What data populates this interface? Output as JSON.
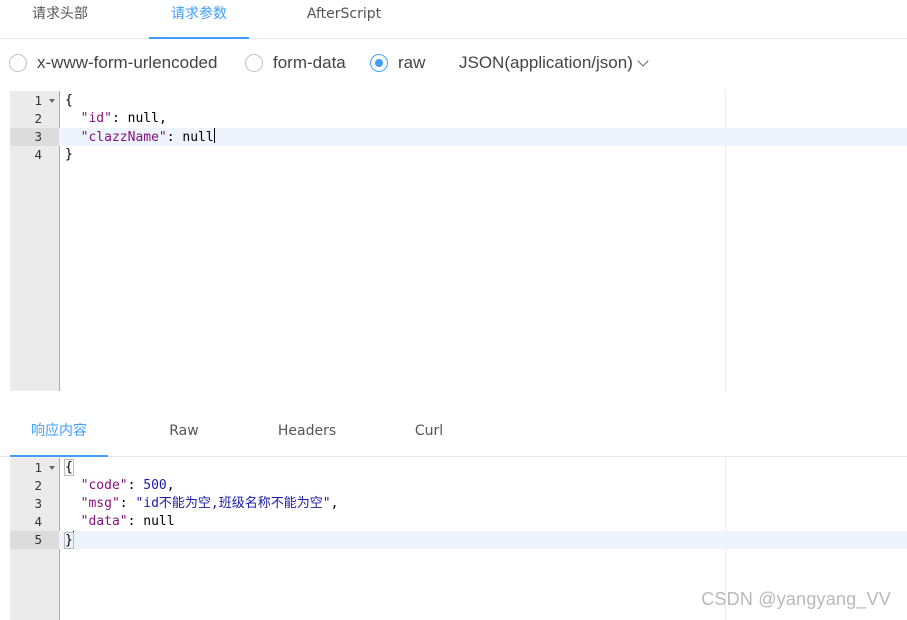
{
  "request_tabs": [
    "请求头部",
    "请求参数",
    "AfterScript"
  ],
  "body_types": {
    "options": [
      "x-www-form-urlencoded",
      "form-data",
      "raw"
    ],
    "selected": "raw",
    "content_type": "JSON(application/json)"
  },
  "request_editor": {
    "line_numbers": [
      "1",
      "2",
      "3",
      "4"
    ],
    "open_brace": "{",
    "close_brace": "}",
    "key_id": "\"id\"",
    "key_clazz": "\"clazzName\"",
    "colon": ": ",
    "null": "null",
    "comma": ","
  },
  "response_tabs": [
    "响应内容",
    "Raw",
    "Headers",
    "Curl"
  ],
  "response_editor": {
    "line_numbers": [
      "1",
      "2",
      "3",
      "4",
      "5"
    ],
    "open_brace": "{",
    "close_brace": "}",
    "key_code": "\"code\"",
    "val_code": "500",
    "key_msg": "\"msg\"",
    "val_msg": "\"id不能为空,班级名称不能为空\"",
    "key_data": "\"data\"",
    "val_data": "null",
    "colon": ": ",
    "comma": ","
  },
  "watermark": "CSDN @yangyang_VV",
  "colors": {
    "accent": "#409eff",
    "gutter": "#ebebeb",
    "active_line": "#edf4fd"
  }
}
